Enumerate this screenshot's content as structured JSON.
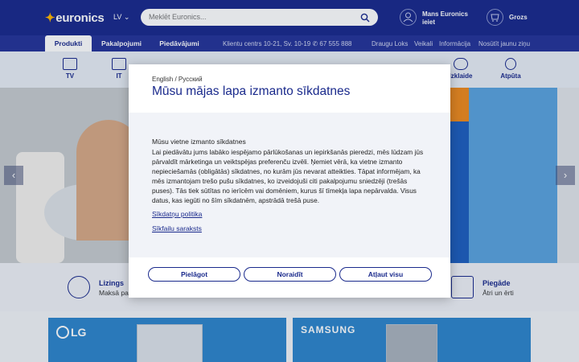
{
  "header": {
    "logo_text": "euronics",
    "language": "LV",
    "search_placeholder": "Meklēt Euronics...",
    "account_line1": "Mans Euronics",
    "account_line2": "ieiet",
    "cart_label": "Grozs"
  },
  "nav": {
    "tabs": [
      "Produkti",
      "Pakalpojumi",
      "Piedāvājumi"
    ],
    "info": "Klientu centrs 10-21, Sv. 10-19",
    "phone": "67 555 888",
    "links": [
      "Draugu Loks",
      "Veikali",
      "Informācija",
      "Nosūtīt jaunu ziņu"
    ]
  },
  "categories": [
    "TV",
    "IT",
    "Izklaide",
    "Atpūta"
  ],
  "features": [
    {
      "title": "Lizings",
      "sub": "Maksā pa"
    },
    {
      "title": "Piegāde",
      "sub": "Ātri un ērti"
    }
  ],
  "brands": {
    "left": "LG",
    "right": "SAMSUNG"
  },
  "modal": {
    "languages": "English / Русский",
    "title": "Mūsu mājas lapa izmanto sīkdatnes",
    "subtitle": "Mūsu vietne izmanto sīkdatnes",
    "body": "Lai piedāvātu jums labāko iespējamo pārlūkošanas un iepirkšanās pieredzi, mēs lūdzam jūs pārvaldīt mārketinga un veiktspējas preferenču izvēli. Ņemiet vērā, ka vietne izmanto nepieciešamās (obligātās) sīkdatnes, no kurām jūs nevarat atteikties. Tāpat informējam, ka mēs izmantojam trešo pušu sīkdatnes, ko izveidojuši citi pakalpojumu sniedzēji (trešās puses). Tās tiek sūtītas no ierīcēm vai domēniem, kurus šī tīmekļa lapa nepārvalda. Visus datus, kas iegūti no šīm sīkdatnēm, apstrādā trešā puse.",
    "link_policy": "Sīkdatņu politika",
    "link_list": "Sīkfailu saraksts",
    "btn_customize": "Pielāgot",
    "btn_reject": "Noraidīt",
    "btn_accept": "Atļaut visu"
  }
}
